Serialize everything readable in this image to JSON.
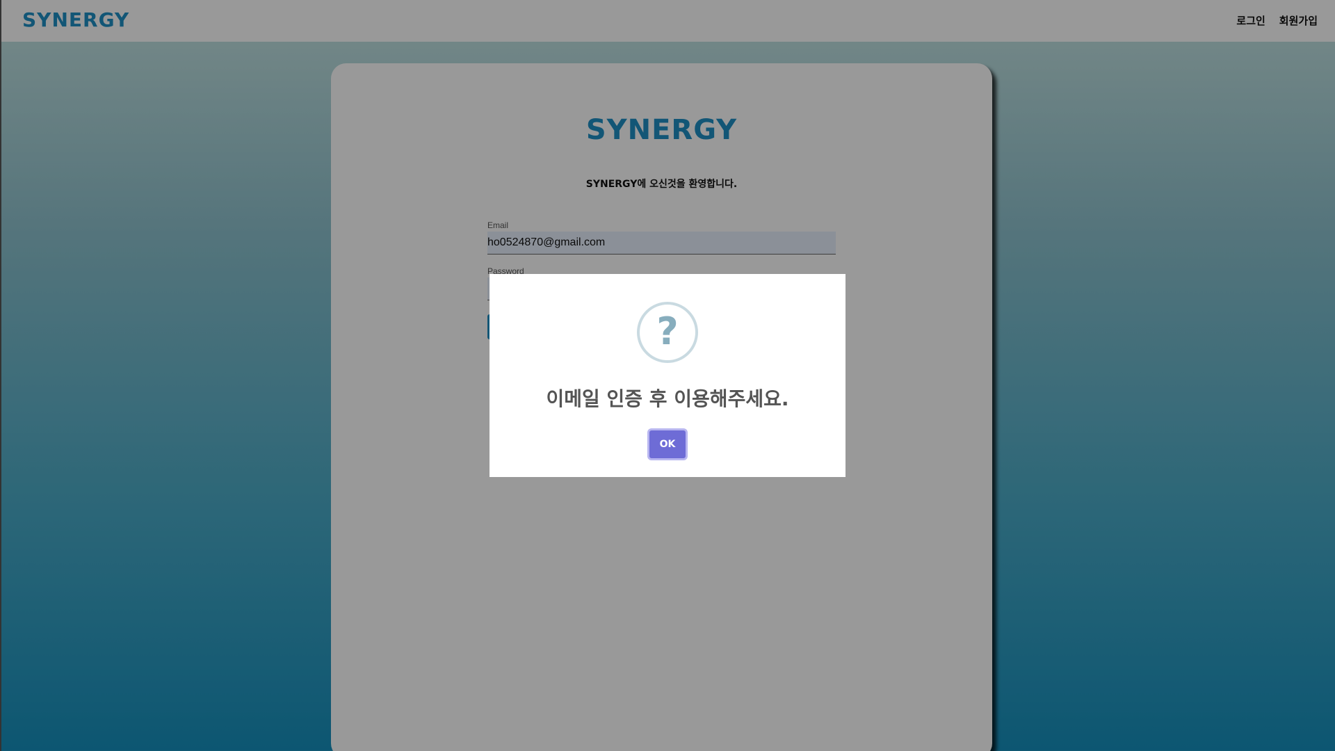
{
  "header": {
    "logo": "SYNERGY",
    "nav": {
      "login": "로그인",
      "signup": "회원가입"
    }
  },
  "card": {
    "logo": "SYNERGY",
    "welcome": "SYNERGY에 오신것을 환영합니다.",
    "email": {
      "label": "Email",
      "value": "ho0524870@gmail.com"
    },
    "password": {
      "label": "Password"
    }
  },
  "modal": {
    "icon": "question-mark-icon",
    "icon_glyph": "?",
    "message": "이메일 인증 후 이용해주세요.",
    "ok_label": "OK"
  },
  "colors": {
    "brand": "#1f8fc5",
    "ok_button": "#6e6cd6"
  }
}
